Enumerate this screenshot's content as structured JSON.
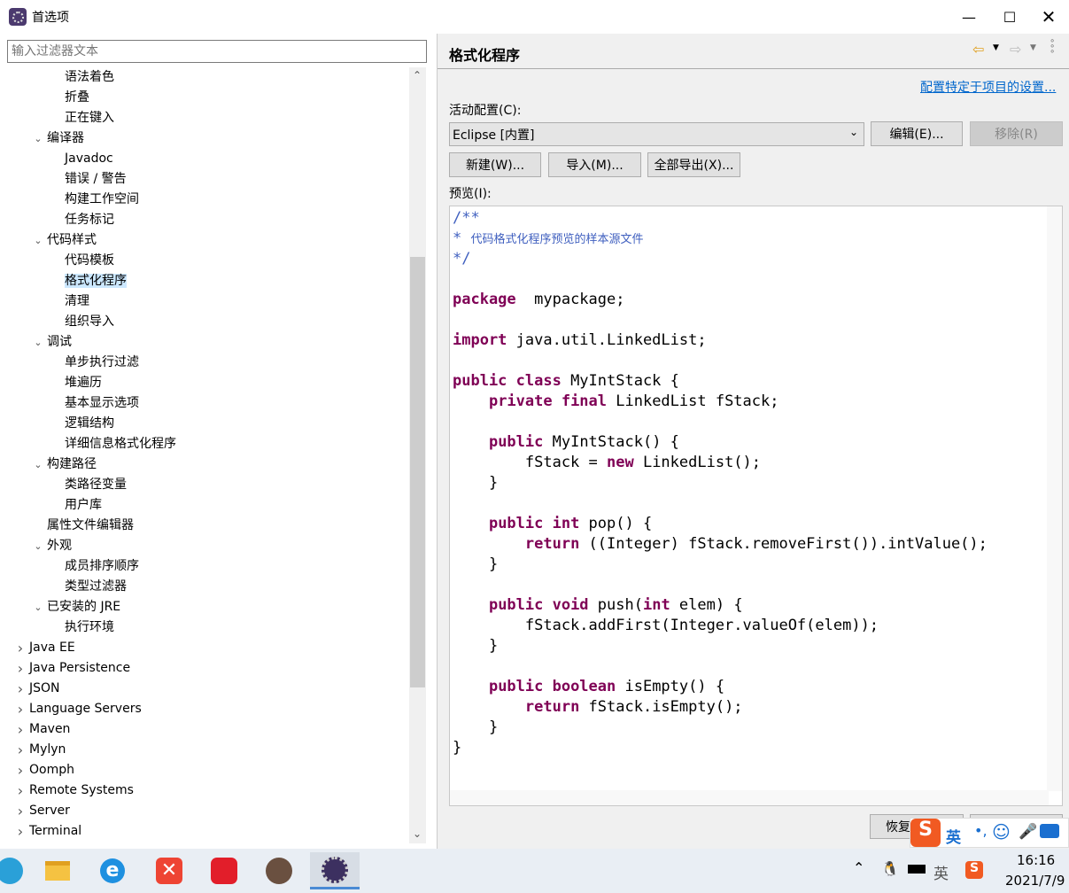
{
  "window": {
    "title": "首选项"
  },
  "filter": {
    "placeholder": "输入过滤器文本"
  },
  "tree": [
    {
      "label": "语法着色",
      "level": 2
    },
    {
      "label": "折叠",
      "level": 2
    },
    {
      "label": "正在键入",
      "level": 2
    },
    {
      "label": "编译器",
      "level": 1,
      "expanded": true
    },
    {
      "label": "Javadoc",
      "level": 2
    },
    {
      "label": "错误 / 警告",
      "level": 2
    },
    {
      "label": "构建工作空间",
      "level": 2
    },
    {
      "label": "任务标记",
      "level": 2
    },
    {
      "label": "代码样式",
      "level": 1,
      "expanded": true
    },
    {
      "label": "代码模板",
      "level": 2
    },
    {
      "label": "格式化程序",
      "level": 2,
      "selected": true
    },
    {
      "label": "清理",
      "level": 2
    },
    {
      "label": "组织导入",
      "level": 2
    },
    {
      "label": "调试",
      "level": 1,
      "expanded": true
    },
    {
      "label": "单步执行过滤",
      "level": 2
    },
    {
      "label": "堆遍历",
      "level": 2
    },
    {
      "label": "基本显示选项",
      "level": 2
    },
    {
      "label": "逻辑结构",
      "level": 2
    },
    {
      "label": "详细信息格式化程序",
      "level": 2
    },
    {
      "label": "构建路径",
      "level": 1,
      "expanded": true
    },
    {
      "label": "类路径变量",
      "level": 2
    },
    {
      "label": "用户库",
      "level": 2
    },
    {
      "label": "属性文件编辑器",
      "level": 1
    },
    {
      "label": "外观",
      "level": 1,
      "expanded": true
    },
    {
      "label": "成员排序顺序",
      "level": 2
    },
    {
      "label": "类型过滤器",
      "level": 2
    },
    {
      "label": "已安装的 JRE",
      "level": 1,
      "expanded": true
    },
    {
      "label": "执行环境",
      "level": 2
    },
    {
      "label": "Java EE",
      "level": 0,
      "expanded": false
    },
    {
      "label": "Java Persistence",
      "level": 0,
      "expanded": false
    },
    {
      "label": "JSON",
      "level": 0,
      "expanded": false
    },
    {
      "label": "Language Servers",
      "level": 0,
      "expanded": false
    },
    {
      "label": "Maven",
      "level": 0,
      "expanded": false
    },
    {
      "label": "Mylyn",
      "level": 0,
      "expanded": false
    },
    {
      "label": "Oomph",
      "level": 0,
      "expanded": false
    },
    {
      "label": "Remote Systems",
      "level": 0,
      "expanded": false
    },
    {
      "label": "Server",
      "level": 0,
      "expanded": false
    },
    {
      "label": "Terminal",
      "level": 0,
      "expanded": false
    }
  ],
  "page": {
    "title": "格式化程序",
    "project_link": "配置特定于项目的设置...",
    "active_profile_label": "活动配置(C):",
    "profile_value": "Eclipse [内置]",
    "edit": "编辑(E)...",
    "remove": "移除(R)",
    "new": "新建(W)...",
    "import": "导入(M)...",
    "export_all": "全部导出(X)...",
    "preview_label": "预览(I):",
    "restore_defaults": "恢复默认值"
  },
  "code": [
    [
      [
        "cm",
        "/**"
      ]
    ],
    [
      [
        "cm",
        "* "
      ],
      [
        "cm cm-cn",
        "代码格式化程序预览的样本源文件"
      ]
    ],
    [
      [
        "cm",
        "*/"
      ]
    ],
    [],
    [
      [
        "kw",
        "package"
      ],
      [
        "",
        "  mypackage;"
      ]
    ],
    [],
    [
      [
        "kw",
        "import"
      ],
      [
        "",
        " java.util.LinkedList;"
      ]
    ],
    [],
    [
      [
        "kw",
        "public class"
      ],
      [
        "",
        " MyIntStack {"
      ]
    ],
    [
      [
        "",
        "    "
      ],
      [
        "kw",
        "private final"
      ],
      [
        "",
        " LinkedList fStack;"
      ]
    ],
    [],
    [
      [
        "",
        "    "
      ],
      [
        "kw",
        "public"
      ],
      [
        "",
        " MyIntStack() {"
      ]
    ],
    [
      [
        "",
        "        fStack = "
      ],
      [
        "kw",
        "new"
      ],
      [
        "",
        " LinkedList();"
      ]
    ],
    [
      [
        "",
        "    }"
      ]
    ],
    [],
    [
      [
        "",
        "    "
      ],
      [
        "kw",
        "public int"
      ],
      [
        "",
        " pop() {"
      ]
    ],
    [
      [
        "",
        "        "
      ],
      [
        "kw",
        "return"
      ],
      [
        "",
        " ((Integer) fStack.removeFirst()).intValue();"
      ]
    ],
    [
      [
        "",
        "    }"
      ]
    ],
    [],
    [
      [
        "",
        "    "
      ],
      [
        "kw",
        "public void"
      ],
      [
        "",
        " push("
      ],
      [
        "kw",
        "int"
      ],
      [
        "",
        " elem) {"
      ]
    ],
    [
      [
        "",
        "        fStack.addFirst(Integer.valueOf(elem));"
      ]
    ],
    [
      [
        "",
        "    }"
      ]
    ],
    [],
    [
      [
        "",
        "    "
      ],
      [
        "kw",
        "public boolean"
      ],
      [
        "",
        " isEmpty() {"
      ]
    ],
    [
      [
        "",
        "        "
      ],
      [
        "kw",
        "return"
      ],
      [
        "",
        " fStack.isEmpty();"
      ]
    ],
    [
      [
        "",
        "    }"
      ]
    ],
    [
      [
        "",
        "}"
      ]
    ]
  ],
  "ime": {
    "lang": "英"
  },
  "tray": {
    "time": "16:16",
    "date": "2021/7/9",
    "lang": "英"
  },
  "colors": {
    "keyword": "#7f0055",
    "comment": "#3f5fbf",
    "link": "#0066cc",
    "selection": "#cce8ff"
  }
}
